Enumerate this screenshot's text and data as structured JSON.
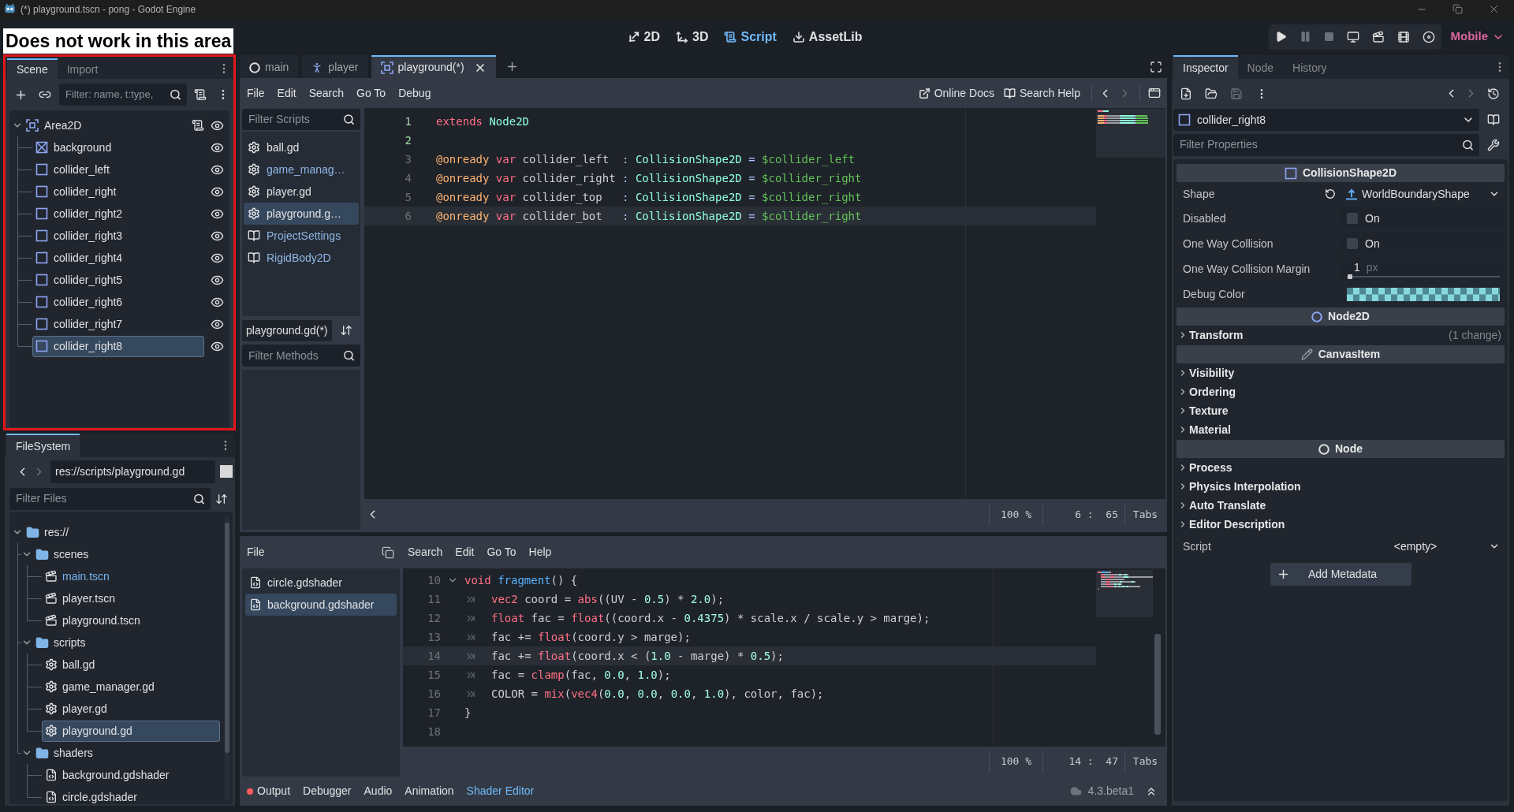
{
  "window": {
    "title": "(*) playground.tscn - pong - Godot Engine"
  },
  "annotation": {
    "text": "Does not work in this area"
  },
  "main_screens": [
    {
      "label": "2D",
      "kind": "canvas",
      "selected": false
    },
    {
      "label": "3D",
      "kind": "spatial",
      "selected": false
    },
    {
      "label": "Script",
      "kind": "script",
      "selected": true
    },
    {
      "label": "AssetLib",
      "kind": "assets",
      "selected": false
    }
  ],
  "run_bar": {
    "buttons": [
      {
        "kind": "play",
        "disabled": false
      },
      {
        "kind": "pause",
        "disabled": true
      },
      {
        "kind": "stop",
        "disabled": true
      },
      {
        "kind": "remote",
        "disabled": false
      },
      {
        "kind": "scene",
        "disabled": false
      },
      {
        "kind": "custom",
        "disabled": false
      },
      {
        "kind": "movie",
        "disabled": false
      }
    ],
    "renderer": "Mobile"
  },
  "scene_dock": {
    "tabs": [
      {
        "label": "Scene",
        "selected": true
      },
      {
        "label": "Import",
        "selected": false
      }
    ],
    "filter": {
      "placeholder": "Filter: name, t:type,"
    },
    "tree": [
      {
        "label": "Area2D",
        "kind": "area",
        "expanded": true,
        "script": true,
        "visible": true,
        "selected": false,
        "children": [
          {
            "label": "background",
            "kind": "texture",
            "script": false,
            "visible": true,
            "selected": false
          },
          {
            "label": "collider_left",
            "kind": "shape",
            "script": false,
            "visible": true,
            "selected": false
          },
          {
            "label": "collider_right",
            "kind": "shape",
            "script": false,
            "visible": true,
            "selected": false
          },
          {
            "label": "collider_right2",
            "kind": "shape",
            "script": false,
            "visible": true,
            "selected": false
          },
          {
            "label": "collider_right3",
            "kind": "shape",
            "script": false,
            "visible": true,
            "selected": false
          },
          {
            "label": "collider_right4",
            "kind": "shape",
            "script": false,
            "visible": true,
            "selected": false
          },
          {
            "label": "collider_right5",
            "kind": "shape",
            "script": false,
            "visible": true,
            "selected": false
          },
          {
            "label": "collider_right6",
            "kind": "shape",
            "script": false,
            "visible": true,
            "selected": false
          },
          {
            "label": "collider_right7",
            "kind": "shape",
            "script": false,
            "visible": true,
            "selected": false
          },
          {
            "label": "collider_right8",
            "kind": "shape",
            "script": false,
            "visible": true,
            "selected": true
          }
        ]
      }
    ]
  },
  "filesystem_dock": {
    "tabs": [
      {
        "label": "FileSystem",
        "selected": true
      }
    ],
    "nav": [
      {
        "kind": "back",
        "disabled": false
      },
      {
        "kind": "forward",
        "disabled": true
      }
    ],
    "path": {
      "value": "res://scripts/playground.gd"
    },
    "filter": {
      "placeholder": "Filter Files"
    },
    "tree": [
      {
        "label": "res://",
        "kind": "folder",
        "expanded": true,
        "selected": false,
        "children": [
          {
            "label": "scenes",
            "kind": "folder",
            "expanded": true,
            "selected": false,
            "children": [
              {
                "label": "main.tscn",
                "kind": "scene",
                "main_scene": true,
                "selected": false
              },
              {
                "label": "player.tscn",
                "kind": "scene",
                "main_scene": false,
                "selected": false
              },
              {
                "label": "playground.tscn",
                "kind": "scene",
                "main_scene": false,
                "selected": false
              }
            ]
          },
          {
            "label": "scripts",
            "kind": "folder",
            "expanded": true,
            "selected": false,
            "children": [
              {
                "label": "ball.gd",
                "kind": "script",
                "selected": false
              },
              {
                "label": "game_manager.gd",
                "kind": "script",
                "selected": false
              },
              {
                "label": "player.gd",
                "kind": "script",
                "selected": false
              },
              {
                "label": "playground.gd",
                "kind": "script",
                "selected": true
              }
            ]
          },
          {
            "label": "shaders",
            "kind": "folder",
            "expanded": true,
            "selected": false,
            "children": [
              {
                "label": "background.gdshader",
                "kind": "shader",
                "selected": false
              },
              {
                "label": "circle.gdshader",
                "kind": "shader",
                "selected": false
              }
            ]
          }
        ]
      }
    ]
  },
  "script_editor": {
    "scene_tabs": [
      {
        "label": "main",
        "kind": "node",
        "selected": false
      },
      {
        "label": "player",
        "kind": "character",
        "selected": false
      },
      {
        "label": "playground(*)",
        "kind": "area",
        "selected": true
      }
    ],
    "menu": [
      "File",
      "Edit",
      "Search",
      "Go To",
      "Debug"
    ],
    "help_links": [
      "Online Docs",
      "Search Help"
    ],
    "nav": [
      {
        "kind": "back",
        "disabled": false
      },
      {
        "kind": "forward",
        "disabled": true
      }
    ],
    "script_filter": {
      "placeholder": "Filter Scripts"
    },
    "scripts": [
      {
        "label": "ball.gd",
        "kind": "script",
        "color": "#dfe0e2",
        "selected": false
      },
      {
        "label": "game_manag…",
        "kind": "script",
        "color": "#8fb6e6",
        "selected": false
      },
      {
        "label": "player.gd",
        "kind": "script",
        "color": "#dfe0e2",
        "selected": false
      },
      {
        "label": "playground.g…",
        "kind": "script",
        "color": "#dfe0e2",
        "selected": true
      },
      {
        "label": "ProjectSettings",
        "kind": "doc",
        "color": "#8fb6e6",
        "selected": false
      },
      {
        "label": "RigidBody2D",
        "kind": "doc",
        "color": "#8fb6e6",
        "selected": false
      }
    ],
    "methods_title": "playground.gd(*)",
    "method_filter": {
      "placeholder": "Filter Methods"
    },
    "lines": [
      {
        "number": "1",
        "safe": true,
        "current": false,
        "tokens": [
          {
            "text": "extends",
            "kind": "keyword"
          },
          {
            "text": " Node2D",
            "kind": "type"
          }
        ]
      },
      {
        "number": "2",
        "safe": true,
        "current": false
      },
      {
        "number": "3",
        "safe": false,
        "current": false,
        "tokens": [
          {
            "text": "@onready",
            "kind": "annotation"
          },
          {
            "text": " var",
            "kind": "keyword"
          },
          {
            "text": " collider_left  ",
            "kind": "plain"
          },
          {
            "text": ":",
            "kind": "symbol"
          },
          {
            "text": " CollisionShape2D",
            "kind": "type"
          },
          {
            "text": " =",
            "kind": "symbol"
          },
          {
            "text": " $collider_left",
            "kind": "nodepath"
          }
        ]
      },
      {
        "number": "4",
        "safe": false,
        "current": false,
        "tokens": [
          {
            "text": "@onready",
            "kind": "annotation"
          },
          {
            "text": " var",
            "kind": "keyword"
          },
          {
            "text": " collider_right ",
            "kind": "plain"
          },
          {
            "text": ":",
            "kind": "symbol"
          },
          {
            "text": " CollisionShape2D",
            "kind": "type"
          },
          {
            "text": " =",
            "kind": "symbol"
          },
          {
            "text": " $collider_right",
            "kind": "nodepath"
          }
        ]
      },
      {
        "number": "5",
        "safe": false,
        "current": false,
        "tokens": [
          {
            "text": "@onready",
            "kind": "annotation"
          },
          {
            "text": " var",
            "kind": "keyword"
          },
          {
            "text": " collider_top   ",
            "kind": "plain"
          },
          {
            "text": ":",
            "kind": "symbol"
          },
          {
            "text": " CollisionShape2D",
            "kind": "type"
          },
          {
            "text": " =",
            "kind": "symbol"
          },
          {
            "text": " $collider_right",
            "kind": "nodepath"
          }
        ]
      },
      {
        "number": "6",
        "safe": false,
        "current": true,
        "tokens": [
          {
            "text": "@onready",
            "kind": "annotation"
          },
          {
            "text": " var",
            "kind": "keyword"
          },
          {
            "text": " collider_bot   ",
            "kind": "plain"
          },
          {
            "text": ":",
            "kind": "symbol"
          },
          {
            "text": " CollisionShape2D",
            "kind": "type"
          },
          {
            "text": " =",
            "kind": "symbol"
          },
          {
            "text": " $collider_right",
            "kind": "nodepath"
          }
        ]
      }
    ],
    "status": {
      "zoom": "100 %",
      "position": "6 :  65",
      "indent": "Tabs"
    }
  },
  "shader_editor": {
    "file_menu": "File",
    "menu": [
      "Search",
      "Edit",
      "Go To",
      "Help"
    ],
    "files": [
      {
        "label": "circle.gdshader",
        "selected": false
      },
      {
        "label": "background.gdshader",
        "selected": true
      }
    ],
    "lines": [
      {
        "number": "10",
        "fold": true,
        "indented": false,
        "current": false,
        "tokens": [
          {
            "text": "void",
            "kind": "keyword"
          },
          {
            "text": " fragment",
            "kind": "function"
          },
          {
            "text": "() {",
            "kind": "plain"
          }
        ]
      },
      {
        "number": "11",
        "fold": false,
        "indented": true,
        "current": false,
        "tokens": [
          {
            "text": "vec2",
            "kind": "keyword"
          },
          {
            "text": " coord = ",
            "kind": "plain"
          },
          {
            "text": "abs",
            "kind": "keyword"
          },
          {
            "text": "((UV - ",
            "kind": "plain"
          },
          {
            "text": "0.5",
            "kind": "number"
          },
          {
            "text": ") * ",
            "kind": "plain"
          },
          {
            "text": "2.0",
            "kind": "number"
          },
          {
            "text": ");",
            "kind": "plain"
          }
        ]
      },
      {
        "number": "12",
        "fold": false,
        "indented": true,
        "current": false,
        "tokens": [
          {
            "text": "float",
            "kind": "keyword"
          },
          {
            "text": " fac = ",
            "kind": "plain"
          },
          {
            "text": "float",
            "kind": "keyword"
          },
          {
            "text": "((coord.x - ",
            "kind": "plain"
          },
          {
            "text": "0.4375",
            "kind": "number"
          },
          {
            "text": ") * scale.x / scale.y > marge);",
            "kind": "plain"
          }
        ]
      },
      {
        "number": "13",
        "fold": false,
        "indented": true,
        "current": false,
        "tokens": [
          {
            "text": "fac += ",
            "kind": "plain"
          },
          {
            "text": "float",
            "kind": "keyword"
          },
          {
            "text": "(coord.y > marge);",
            "kind": "plain"
          }
        ]
      },
      {
        "number": "14",
        "fold": false,
        "indented": true,
        "current": true,
        "tokens": [
          {
            "text": "fac += ",
            "kind": "plain"
          },
          {
            "text": "float",
            "kind": "keyword"
          },
          {
            "text": "(coord.x < (",
            "kind": "plain"
          },
          {
            "text": "1.0",
            "kind": "number"
          },
          {
            "text": " - marge) * ",
            "kind": "plain"
          },
          {
            "text": "0.5",
            "kind": "number"
          },
          {
            "text": ");",
            "kind": "plain"
          }
        ]
      },
      {
        "number": "15",
        "fold": false,
        "indented": true,
        "current": false,
        "tokens": [
          {
            "text": "fac = ",
            "kind": "plain"
          },
          {
            "text": "clamp",
            "kind": "keyword"
          },
          {
            "text": "(fac, ",
            "kind": "plain"
          },
          {
            "text": "0.0",
            "kind": "number"
          },
          {
            "text": ", ",
            "kind": "plain"
          },
          {
            "text": "1.0",
            "kind": "number"
          },
          {
            "text": ");",
            "kind": "plain"
          }
        ]
      },
      {
        "number": "16",
        "fold": false,
        "indented": true,
        "current": false,
        "tokens": [
          {
            "text": "COLOR = ",
            "kind": "plain"
          },
          {
            "text": "mix",
            "kind": "keyword"
          },
          {
            "text": "(",
            "kind": "plain"
          },
          {
            "text": "vec4",
            "kind": "keyword"
          },
          {
            "text": "(",
            "kind": "plain"
          },
          {
            "text": "0.0",
            "kind": "number"
          },
          {
            "text": ", ",
            "kind": "plain"
          },
          {
            "text": "0.0",
            "kind": "number"
          },
          {
            "text": ", ",
            "kind": "plain"
          },
          {
            "text": "0.0",
            "kind": "number"
          },
          {
            "text": ", ",
            "kind": "plain"
          },
          {
            "text": "1.0",
            "kind": "number"
          },
          {
            "text": "), color, fac);",
            "kind": "plain"
          }
        ]
      },
      {
        "number": "17",
        "fold": false,
        "indented": false,
        "current": false,
        "tokens": [
          {
            "text": "}",
            "kind": "plain"
          }
        ]
      },
      {
        "number": "18",
        "fold": false,
        "indented": false,
        "current": false
      }
    ],
    "status": {
      "zoom": "100 %",
      "position": "14 :  47",
      "indent": "Tabs"
    }
  },
  "bottom_panel": {
    "tabs": [
      {
        "label": "Output",
        "alert": true,
        "selected": false
      },
      {
        "label": "Debugger",
        "alert": false,
        "selected": false
      },
      {
        "label": "Audio",
        "alert": false,
        "selected": false
      },
      {
        "label": "Animation",
        "alert": false,
        "selected": false
      },
      {
        "label": "Shader Editor",
        "alert": false,
        "selected": true
      }
    ],
    "version": "4.3.beta1"
  },
  "inspector": {
    "tabs": [
      {
        "label": "Inspector",
        "selected": true
      },
      {
        "label": "Node",
        "selected": false
      },
      {
        "label": "History",
        "selected": false
      }
    ],
    "toolbar": [
      {
        "kind": "new",
        "disabled": false
      },
      {
        "kind": "open",
        "disabled": false
      },
      {
        "kind": "save",
        "disabled": true
      },
      {
        "kind": "more",
        "disabled": false
      }
    ],
    "nav": [
      {
        "kind": "back",
        "disabled": false
      },
      {
        "kind": "forward",
        "disabled": true
      }
    ],
    "object": {
      "value": "collider_right8"
    },
    "filter": {
      "placeholder": "Filter Properties"
    },
    "sections": [
      {
        "title": "CollisionShape2D",
        "kind": "shape",
        "rows": [
          {
            "kind": "resource",
            "label": "Shape",
            "value": "WorldBoundaryShape"
          },
          {
            "kind": "check",
            "label": "Disabled",
            "text": "On",
            "checked": false
          },
          {
            "kind": "check",
            "label": "One Way Collision",
            "text": "On",
            "checked": false
          },
          {
            "kind": "range",
            "label": "One Way Collision Margin",
            "value": "1",
            "suffix": "px",
            "level": 0.01
          },
          {
            "kind": "color",
            "label": "Debug Color",
            "color": "#86d8de"
          }
        ]
      },
      {
        "title": "Node2D",
        "kind": "node2d",
        "rows": [
          {
            "kind": "group",
            "label": "Transform",
            "note": "(1 change)",
            "expanded": false
          }
        ]
      },
      {
        "title": "CanvasItem",
        "kind": "canvas",
        "rows": [
          {
            "kind": "group",
            "label": "Visibility",
            "expanded": false
          },
          {
            "kind": "group",
            "label": "Ordering",
            "expanded": false
          },
          {
            "kind": "group",
            "label": "Texture",
            "expanded": false
          },
          {
            "kind": "group",
            "label": "Material",
            "expanded": false
          }
        ]
      },
      {
        "title": "Node",
        "kind": "node",
        "rows": [
          {
            "kind": "group",
            "label": "Process",
            "expanded": false
          },
          {
            "kind": "group",
            "label": "Physics Interpolation",
            "expanded": false
          },
          {
            "kind": "group",
            "label": "Auto Translate",
            "expanded": false
          },
          {
            "kind": "group",
            "label": "Editor Description",
            "expanded": false
          },
          {
            "kind": "dropdown",
            "label": "Script",
            "value": "<empty>"
          }
        ]
      }
    ],
    "add_button": "Add Metadata"
  }
}
